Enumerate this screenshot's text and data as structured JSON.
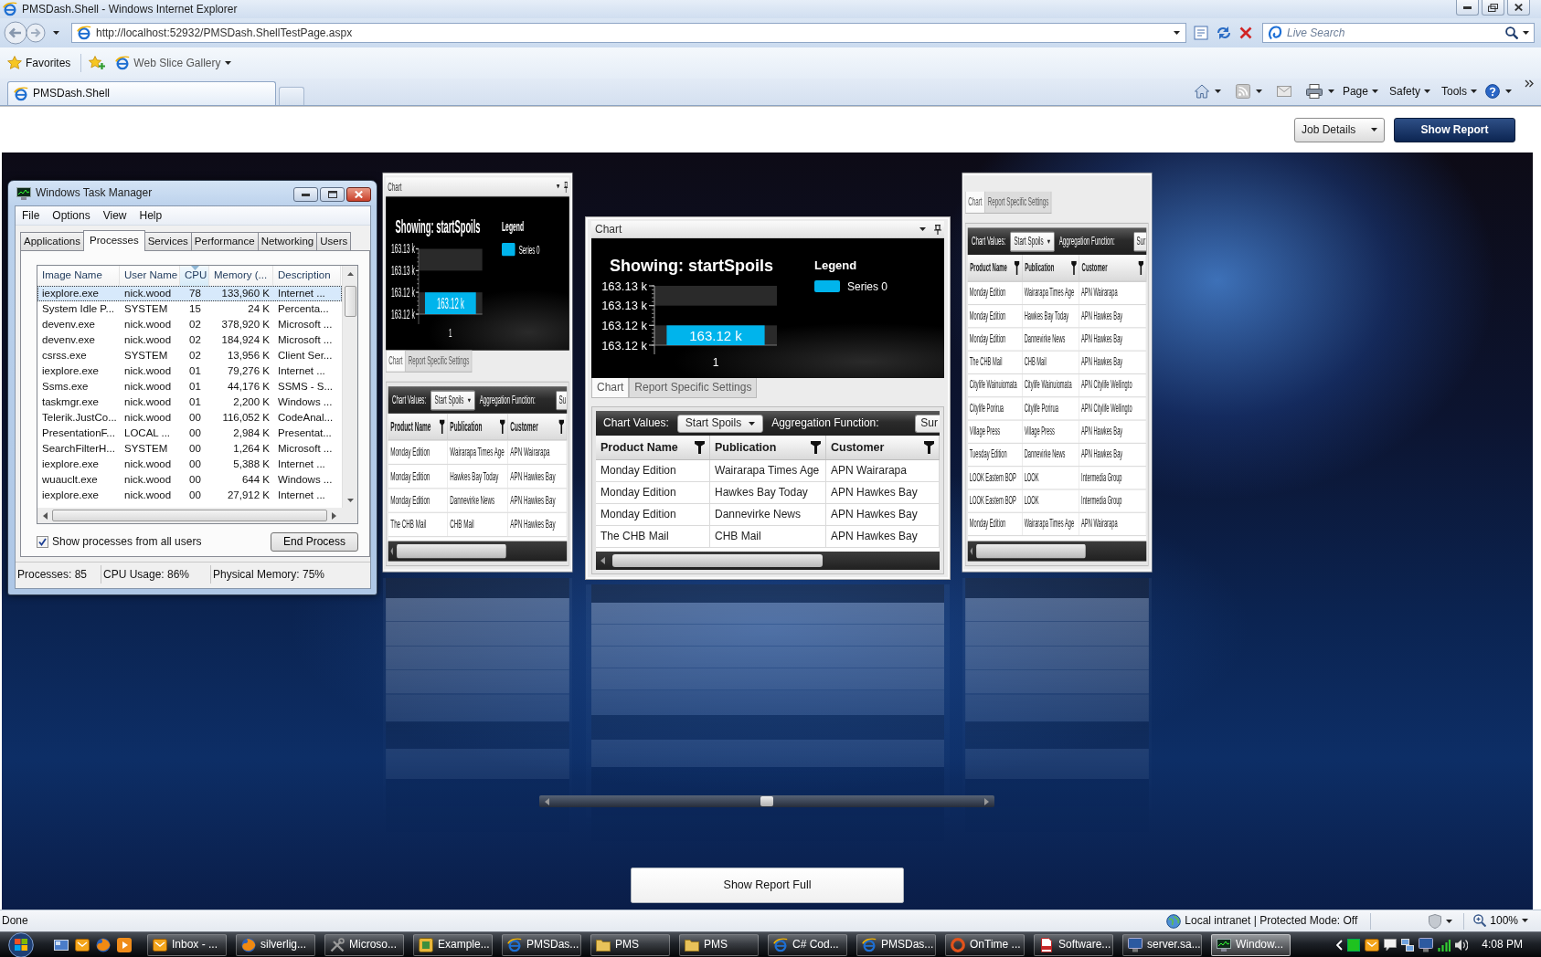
{
  "window": {
    "title": "PMSDash.Shell - Windows Internet Explorer"
  },
  "address_bar": {
    "url": "http://localhost:52932/PMSDash.ShellTestPage.aspx"
  },
  "search": {
    "placeholder": "Live Search"
  },
  "favorites_bar": {
    "favorites": "Favorites",
    "items": [
      "Web Slice Gallery"
    ]
  },
  "tabs": [
    {
      "label": "PMSDash.Shell",
      "selected": true
    }
  ],
  "command_bar": {
    "menus": [
      "Page",
      "Safety",
      "Tools"
    ]
  },
  "page_header": {
    "dropdown": "Job Details",
    "button": "Show Report"
  },
  "task_manager": {
    "title": "Windows Task Manager",
    "menu": [
      "File",
      "Options",
      "View",
      "Help"
    ],
    "tabs": [
      {
        "label": "Applications",
        "selected": false
      },
      {
        "label": "Processes",
        "selected": true
      },
      {
        "label": "Services",
        "selected": false
      },
      {
        "label": "Performance",
        "selected": false
      },
      {
        "label": "Networking",
        "selected": false
      },
      {
        "label": "Users",
        "selected": false
      }
    ],
    "columns": [
      {
        "label": "Image Name",
        "sorted": false
      },
      {
        "label": "User Name",
        "sorted": false
      },
      {
        "label": "CPU",
        "sorted": true
      },
      {
        "label": "Memory (...",
        "sorted": false
      },
      {
        "label": "Description",
        "sorted": false
      }
    ],
    "rows": [
      {
        "cells": [
          "iexplore.exe",
          "nick.wood",
          "78",
          "133,960 K",
          "Internet ..."
        ],
        "selected": true
      },
      {
        "cells": [
          "System Idle P...",
          "SYSTEM",
          "15",
          "24 K",
          "Percenta..."
        ],
        "selected": false
      },
      {
        "cells": [
          "devenv.exe",
          "nick.wood",
          "02",
          "378,920 K",
          "Microsoft ..."
        ],
        "selected": false
      },
      {
        "cells": [
          "devenv.exe",
          "nick.wood",
          "02",
          "184,924 K",
          "Microsoft ..."
        ],
        "selected": false
      },
      {
        "cells": [
          "csrss.exe",
          "SYSTEM",
          "02",
          "13,956 K",
          "Client Ser..."
        ],
        "selected": false
      },
      {
        "cells": [
          "iexplore.exe",
          "nick.wood",
          "01",
          "79,276 K",
          "Internet ..."
        ],
        "selected": false
      },
      {
        "cells": [
          "Ssms.exe",
          "nick.wood",
          "01",
          "44,176 K",
          "SSMS - S..."
        ],
        "selected": false
      },
      {
        "cells": [
          "taskmgr.exe",
          "nick.wood",
          "01",
          "2,200 K",
          "Windows ..."
        ],
        "selected": false
      },
      {
        "cells": [
          "Telerik.JustCo...",
          "nick.wood",
          "00",
          "116,052 K",
          "CodeAnal..."
        ],
        "selected": false
      },
      {
        "cells": [
          "PresentationF...",
          "LOCAL ...",
          "00",
          "2,984 K",
          "Presentat..."
        ],
        "selected": false
      },
      {
        "cells": [
          "SearchFilterH...",
          "SYSTEM",
          "00",
          "1,264 K",
          "Microsoft ..."
        ],
        "selected": false
      },
      {
        "cells": [
          "iexplore.exe",
          "nick.wood",
          "00",
          "5,388 K",
          "Internet ..."
        ],
        "selected": false
      },
      {
        "cells": [
          "wuauclt.exe",
          "nick.wood",
          "00",
          "644 K",
          "Windows ..."
        ],
        "selected": false
      },
      {
        "cells": [
          "iexplore.exe",
          "nick.wood",
          "00",
          "27,912 K",
          "Internet ..."
        ],
        "selected": false
      }
    ],
    "show_all_users": {
      "label": "Show processes from all users",
      "checked": true
    },
    "end_process": "End Process",
    "status": [
      "Processes: 85",
      "CPU Usage: 86%",
      "Physical Memory: 75%"
    ]
  },
  "panels": [
    {
      "title": "Chart",
      "chart_data": {
        "type": "bar",
        "title": "Showing: startSpoils",
        "categories": [
          "1"
        ],
        "series": [
          {
            "name": "Series 0",
            "color": "#00b4ec",
            "values": [
              163.1235
            ]
          }
        ],
        "ylim": [
          163.1215,
          163.1275
        ],
        "yticks": [
          {
            "value": 163.1275,
            "label": "163.13 k"
          },
          {
            "value": 163.1255,
            "label": "163.13 k"
          },
          {
            "value": 163.1235,
            "label": "163.12 k"
          },
          {
            "value": 163.1215,
            "label": "163.12 k"
          }
        ],
        "value_labels": [
          "163.12 k"
        ]
      },
      "legend_title": "Legend",
      "tabs": [
        {
          "label": "Chart",
          "selected": true
        },
        {
          "label": "Report Specific Settings",
          "selected": false
        }
      ],
      "toolbar": {
        "chart_values_label": "Chart Values:",
        "chart_values": "Start Spoils",
        "aggregation_label": "Aggregation Function:",
        "aggregation": "Su"
      },
      "columns": [
        "Product Name",
        "Publication",
        "Customer"
      ],
      "rows": [
        [
          "Monday Edition",
          "Wairarapa Times Age",
          "APN Wairarapa"
        ],
        [
          "Monday Edition",
          "Hawkes Bay Today",
          "APN Hawkes Bay"
        ],
        [
          "Monday Edition",
          "Dannevirke News",
          "APN Hawkes Bay"
        ],
        [
          "The CHB Mail",
          "CHB Mail",
          "APN Hawkes Bay"
        ]
      ]
    },
    {
      "title": "Chart",
      "chart_data": {
        "type": "bar",
        "title": "Showing: startSpoils",
        "categories": [
          "1"
        ],
        "series": [
          {
            "name": "Series 0",
            "color": "#00b4ec",
            "values": [
              163.1235
            ]
          }
        ],
        "ylim": [
          163.1215,
          163.1275
        ],
        "yticks": [
          {
            "value": 163.1275,
            "label": "163.13 k"
          },
          {
            "value": 163.1255,
            "label": "163.13 k"
          },
          {
            "value": 163.1235,
            "label": "163.12 k"
          },
          {
            "value": 163.1215,
            "label": "163.12 k"
          }
        ],
        "value_labels": [
          "163.12 k"
        ]
      },
      "legend_title": "Legend",
      "tabs": [
        {
          "label": "Chart",
          "selected": true
        },
        {
          "label": "Report Specific Settings",
          "selected": false
        }
      ],
      "toolbar": {
        "chart_values_label": "Chart Values:",
        "chart_values": "Start Spoils",
        "aggregation_label": "Aggregation Function:",
        "aggregation": "Sur"
      },
      "columns": [
        "Product Name",
        "Publication",
        "Customer"
      ],
      "rows": [
        [
          "Monday Edition",
          "Wairarapa Times Age",
          "APN Wairarapa"
        ],
        [
          "Monday Edition",
          "Hawkes Bay Today",
          "APN Hawkes Bay"
        ],
        [
          "Monday Edition",
          "Dannevirke News",
          "APN Hawkes Bay"
        ],
        [
          "The CHB Mail",
          "CHB Mail",
          "APN Hawkes Bay"
        ]
      ]
    },
    {
      "tabs": [
        {
          "label": "Chart",
          "selected": true
        },
        {
          "label": "Report Specific Settings",
          "selected": false
        }
      ],
      "toolbar": {
        "chart_values_label": "Chart Values:",
        "chart_values": "Start Spoils",
        "aggregation_label": "Aggregation Function:",
        "aggregation": "Sur"
      },
      "columns": [
        "Product Name",
        "Publication",
        "Customer"
      ],
      "rows": [
        [
          "Monday Edition",
          "Wairarapa Times Age",
          "APN Wairarapa"
        ],
        [
          "Monday Edition",
          "Hawkes Bay Today",
          "APN Hawkes Bay"
        ],
        [
          "Monday Edition",
          "Dannevirke News",
          "APN Hawkes Bay"
        ],
        [
          "The CHB Mail",
          "CHB Mail",
          "APN Hawkes Bay"
        ],
        [
          "Citylife Wainuiomata",
          "Citylife Wainuiomata",
          "APN Citylife Wellingto"
        ],
        [
          "Citylife Porirua",
          "Citylife Porirua",
          "APN Citylife Wellingto"
        ],
        [
          "Village Press",
          "Village Press",
          "APN Hawkes Bay"
        ],
        [
          "Tuesday Edition",
          "Dannevirke News",
          "APN Hawkes Bay"
        ],
        [
          "LOOK Eastern BOP",
          "LOOK",
          "Intermedia Group"
        ],
        [
          "LOOK Eastern BOP",
          "LOOK",
          "Intermedia Group"
        ],
        [
          "Monday Edition",
          "Wairarapa Times Age",
          "APN Wairarapa"
        ]
      ]
    }
  ],
  "show_full_button": "Show Report Full",
  "status_bar": {
    "text": "Done",
    "zone": "Local intranet | Protected Mode: Off",
    "zoom": "100%"
  },
  "taskbar": {
    "buttons": [
      {
        "label": "Inbox - ...",
        "selected": false
      },
      {
        "label": "silverlig...",
        "selected": false
      },
      {
        "label": "Microso...",
        "selected": false
      },
      {
        "label": "Example...",
        "selected": false
      },
      {
        "label": "PMSDas...",
        "selected": false
      },
      {
        "label": "PMS",
        "selected": false
      },
      {
        "label": "PMS",
        "selected": false
      },
      {
        "label": "C# Cod...",
        "selected": false
      },
      {
        "label": "PMSDas...",
        "selected": false
      },
      {
        "label": "OnTime ...",
        "selected": false
      },
      {
        "label": "Software...",
        "selected": false
      },
      {
        "label": "server.sa...",
        "selected": false
      },
      {
        "label": "Window...",
        "selected": true
      }
    ],
    "clock": "4:08 PM"
  }
}
